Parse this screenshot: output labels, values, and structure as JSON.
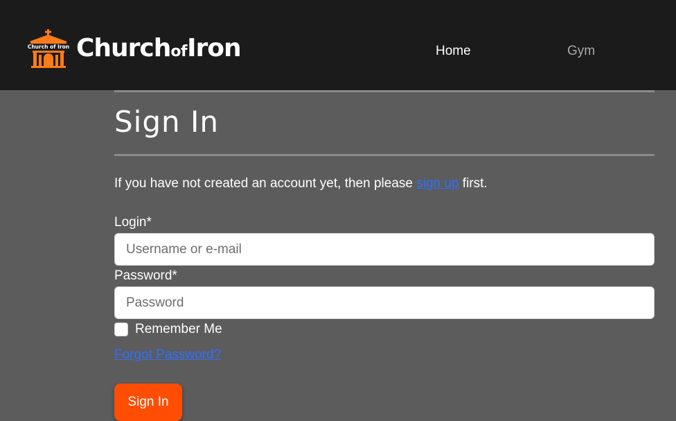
{
  "navbar": {
    "brand": {
      "logo_text": "Church of Iron",
      "name_part1": "Church",
      "name_part2": "of",
      "name_part3": "Iron"
    },
    "links": [
      {
        "label": "Home"
      },
      {
        "label": "Gym"
      }
    ]
  },
  "page": {
    "title": "Sign In",
    "intro_before": "If you have not created an account yet, then please ",
    "intro_link": "sign up",
    "intro_after": " first."
  },
  "form": {
    "login_label": "Login*",
    "login_placeholder": "Username or e-mail",
    "login_value": "",
    "password_label": "Password*",
    "password_placeholder": "Password",
    "password_value": "",
    "remember_label": "Remember Me",
    "remember_checked": false,
    "forgot_label": "Forgot Password?",
    "submit_label": "Sign In"
  },
  "colors": {
    "navbar_bg": "#1b1b1b",
    "page_bg": "#5c5c5c",
    "accent": "#ff4d04",
    "link": "#2f6fff"
  },
  "icons": {
    "logo": "church-building-icon"
  }
}
